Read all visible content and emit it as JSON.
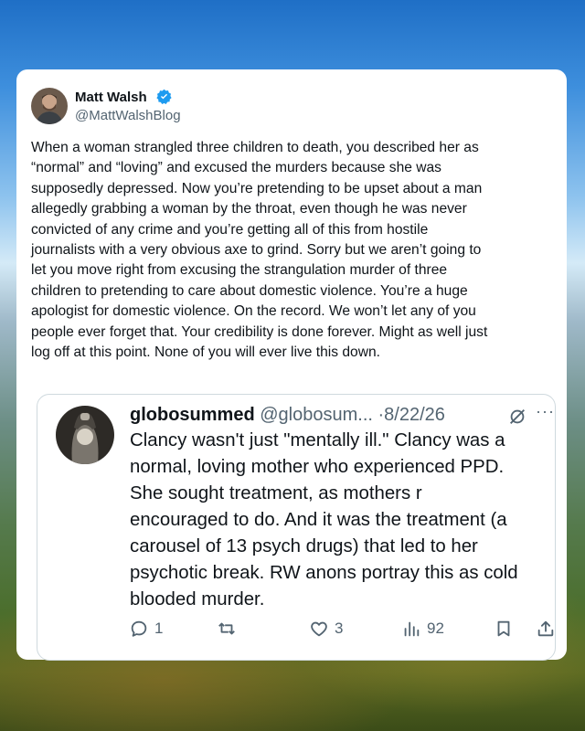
{
  "tweet": {
    "author": {
      "display_name": "Matt Walsh",
      "handle": "@MattWalshBlog",
      "verified": true,
      "avatar_icon": "user-avatar"
    },
    "text": "When a woman strangled three children to death, you described her as\n“normal” and “loving” and excused the murders because she was\nsupposedly depressed. Now you’re pretending to be upset about a man\nallegedly grabbing a woman by the throat, even though he was never\nconvicted of any crime and you’re getting all of this from hostile\njournalists with a very obvious axe to grind. Sorry but we aren’t going to\nlet you move right from excusing the strangulation murder of three\nchildren to pretending to care about domestic violence. You’re a huge\napologist for domestic violence. On the record. We won’t let any of you\npeople ever forget that. Your credibility is done forever. Might as well just\nlog off at this point. None of you will ever live this down."
  },
  "quoted_tweet": {
    "display_name": "globosummed",
    "handle": "@globosum...",
    "separator": "·",
    "date": "8/22/26",
    "text": "Clancy wasn't just \"mentally ill.\" Clancy was a\nnormal, loving mother who experienced PPD.\nShe sought treatment, as mothers r\nencouraged to do. And it was the treatment (a\ncarousel of 13 psych drugs) that led to her\npsychotic break. RW anons portray this as cold\nblooded murder.",
    "more_label": "···",
    "actions": {
      "replies": "1",
      "retweets": "",
      "likes": "3",
      "views": "92"
    }
  },
  "colors": {
    "verified_blue": "#1d9bf0",
    "text_primary": "#0f1419",
    "text_secondary": "#536471",
    "border": "#cfd9de"
  }
}
